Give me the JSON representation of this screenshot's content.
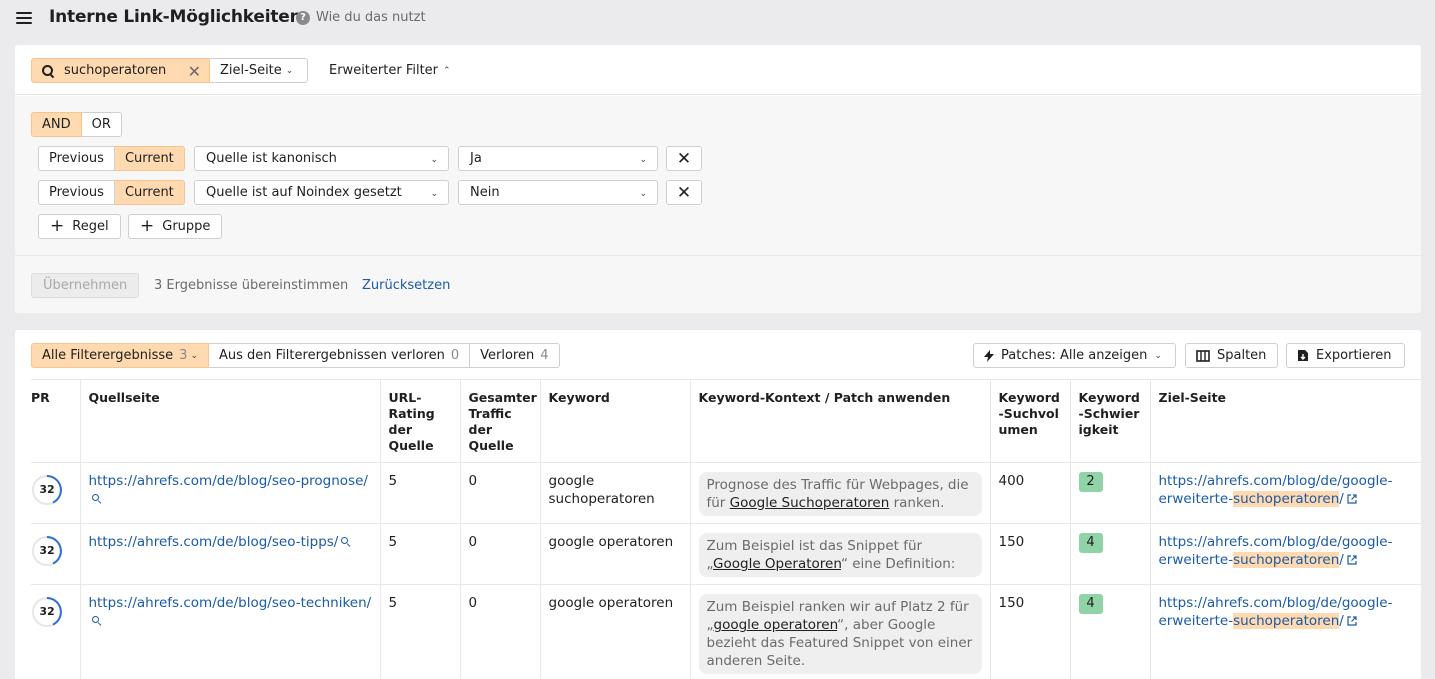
{
  "header": {
    "title": "Interne Link-Möglichkeiten",
    "help_label": "Wie du das nutzt"
  },
  "filter_bar": {
    "search_value": "suchoperatoren",
    "target_label": "Ziel-Seite",
    "advanced_label": "Erweiterter Filter"
  },
  "rules": {
    "and_label": "AND",
    "or_label": "OR",
    "items": [
      {
        "previous": "Previous",
        "current": "Current",
        "field": "Quelle ist kanonisch",
        "value": "Ja"
      },
      {
        "previous": "Previous",
        "current": "Current",
        "field": "Quelle ist auf Noindex gesetzt",
        "value": "Nein"
      }
    ],
    "add_rule": "Regel",
    "add_group": "Gruppe"
  },
  "footer": {
    "apply": "Übernehmen",
    "matches": "3 Ergebnisse übereinstimmen",
    "reset": "Zurücksetzen"
  },
  "results": {
    "tabs": [
      {
        "label": "Alle Filterergebnisse",
        "count": "3"
      },
      {
        "label": "Aus den Filterergebnissen verloren",
        "count": "0"
      },
      {
        "label": "Verloren",
        "count": "4"
      }
    ],
    "patches_label": "Patches: Alle anzeigen",
    "columns_label": "Spalten",
    "export_label": "Exportieren"
  },
  "table": {
    "headers": {
      "pr": "PR",
      "source": "Quellseite",
      "url_rating": "URL-Rating der Quelle",
      "traffic": "Gesamter Traffic der Quelle",
      "keyword": "Keyword",
      "context": "Keyword-Kontext / Patch anwenden",
      "volume": "Keyword-Suchvolumen",
      "difficulty": "Keyword-Schwierigkeit",
      "target": "Ziel-Seite"
    },
    "rows": [
      {
        "pr": "32",
        "source": "https://ahrefs.com/de/blog/seo-prognose/",
        "url_rating": "5",
        "traffic": "0",
        "keyword": "google suchoperatoren",
        "context_before": "Prognose des Traffic für Webpages, die für ",
        "context_link": "Google Suchoperatoren",
        "context_after": " ranken.",
        "volume": "400",
        "difficulty": "2",
        "target_prefix": "https://ahrefs.com/blog/de/google-erweiterte-",
        "target_highlight": "suchoperatoren",
        "target_suffix": "/"
      },
      {
        "pr": "32",
        "source": "https://ahrefs.com/de/blog/seo-tipps/",
        "url_rating": "5",
        "traffic": "0",
        "keyword": "google operatoren",
        "context_before": "Zum Beispiel ist das Snippet für „",
        "context_link": "Google Operatoren",
        "context_after": "“ eine Definition:",
        "volume": "150",
        "difficulty": "4",
        "target_prefix": "https://ahrefs.com/blog/de/google-erweiterte-",
        "target_highlight": "suchoperatoren",
        "target_suffix": "/"
      },
      {
        "pr": "32",
        "source": "https://ahrefs.com/de/blog/seo-techniken/",
        "url_rating": "5",
        "traffic": "0",
        "keyword": "google operatoren",
        "context_before": "Zum Beispiel ranken wir auf Platz 2 für „",
        "context_link": "google operatoren",
        "context_after": "“, aber Google bezieht das Featured Snippet von einer anderen Seite.",
        "volume": "150",
        "difficulty": "4",
        "target_prefix": "https://ahrefs.com/blog/de/google-erweiterte-",
        "target_highlight": "suchoperatoren",
        "target_suffix": "/"
      }
    ]
  },
  "colors": {
    "active_orange": "#ffd9b0",
    "link_blue": "#1a5aa8",
    "kd_green": "#8fd3a7",
    "pr_ring": "#2f6fd1"
  },
  "icons": [
    "menu-icon",
    "help-icon",
    "search-icon",
    "close-icon",
    "chevron-down-icon",
    "chevron-up-icon",
    "plus-icon",
    "bolt-icon",
    "columns-icon",
    "export-icon",
    "magnifier-icon",
    "external-link-icon"
  ]
}
